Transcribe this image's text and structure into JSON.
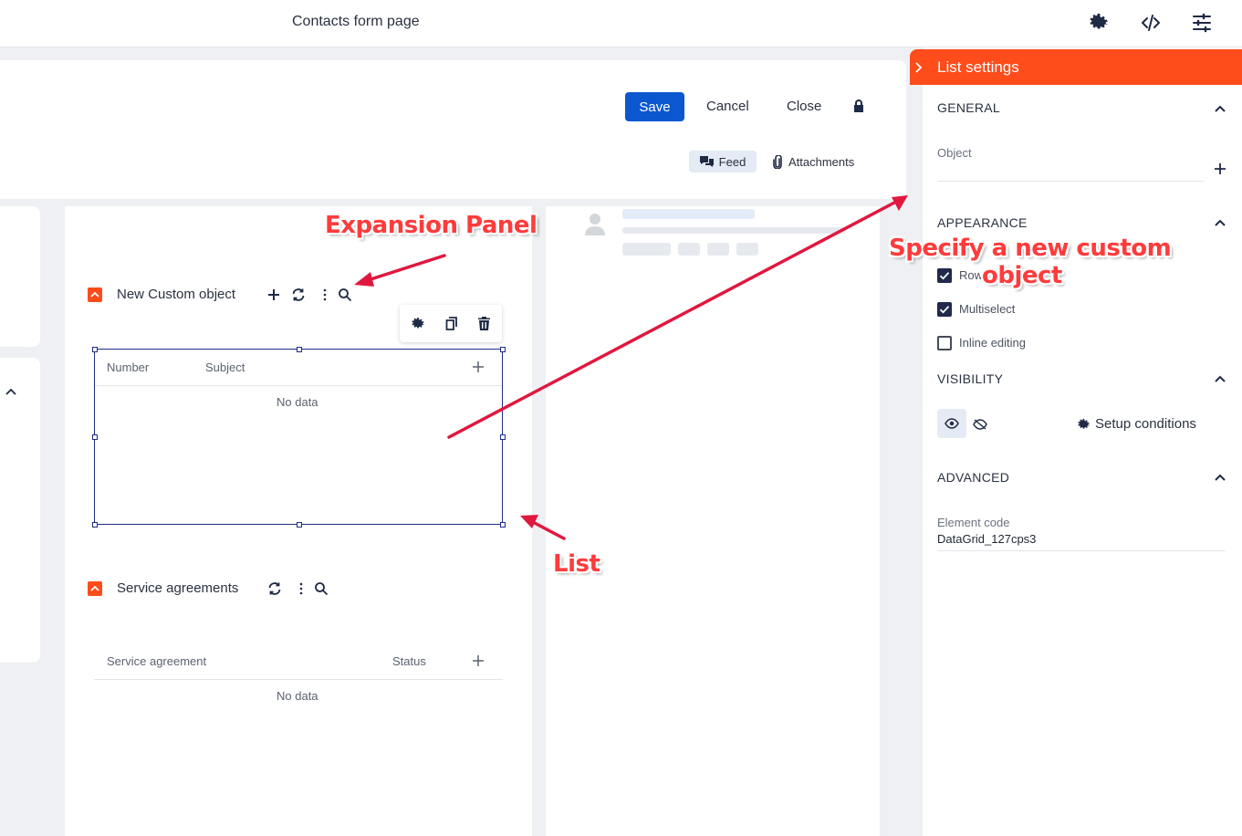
{
  "topbar": {
    "title": "Contacts form page",
    "icons": [
      "gear-settings-icon",
      "code-icon",
      "sliders-icon"
    ]
  },
  "header": {
    "save_label": "Save",
    "cancel_label": "Cancel",
    "close_label": "Close",
    "feed_label": "Feed",
    "attachments_label": "Attachments"
  },
  "custom_object_panel": {
    "title": "New Custom object",
    "columns": [
      "Number",
      "Subject"
    ],
    "empty_text": "No data"
  },
  "service_panel": {
    "title": "Service agreements",
    "columns": [
      "Service agreement",
      "Status"
    ],
    "empty_text": "No data"
  },
  "settings": {
    "header": "List settings",
    "general": {
      "title": "GENERAL",
      "object_label": "Object"
    },
    "appearance": {
      "title": "APPEARANCE",
      "options": [
        {
          "label": "Row",
          "checked": true
        },
        {
          "label": "Multiselect",
          "checked": true
        },
        {
          "label": "Inline editing",
          "checked": false
        }
      ]
    },
    "visibility": {
      "title": "VISIBILITY",
      "setup_label": "Setup conditions"
    },
    "advanced": {
      "title": "ADVANCED",
      "code_label": "Element code",
      "code_value": "DataGrid_127cps3"
    }
  },
  "annotations": {
    "expansion_panel": "Expansion Panel",
    "list": "List",
    "custom_object_line1": "Specify a new custom",
    "custom_object_line2": "object"
  },
  "colors": {
    "accent": "#ff4c1a",
    "primary": "#0b57d0",
    "annotation": "#ff3b3b",
    "arrow": "#e0173f"
  }
}
